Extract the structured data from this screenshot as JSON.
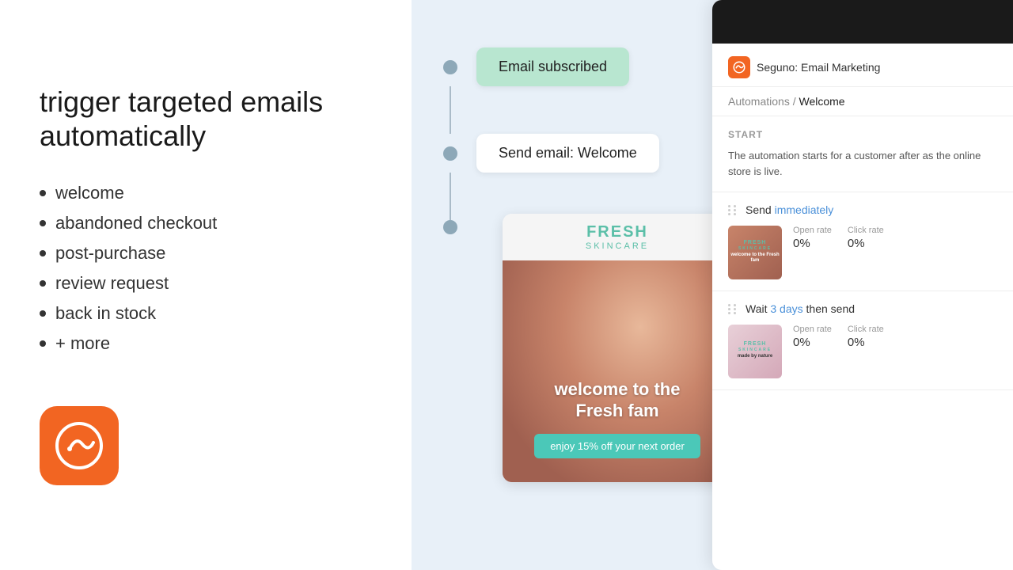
{
  "left": {
    "headline": "trigger targeted emails automatically",
    "bullets": [
      "welcome",
      "abandoned checkout",
      "post-purchase",
      "review request",
      "back in stock",
      "+ more"
    ]
  },
  "workflow": {
    "trigger_label": "Email subscribed",
    "action_label": "Send email: Welcome"
  },
  "email_preview": {
    "brand": "FRESH",
    "brand_sub": "SKINCARE",
    "welcome_line1": "welcome to the",
    "welcome_line2": "Fresh fam",
    "cta": "enjoy 15% off your next order"
  },
  "app": {
    "logo_alt": "Seguno logo",
    "app_name": "Seguno: Email Marketing",
    "breadcrumb_parent": "Automations",
    "breadcrumb_separator": "/",
    "breadcrumb_current": "Welcome",
    "start_label": "START",
    "start_desc": "The automation starts for a customer after as the online store is live.",
    "send_row": {
      "prefix": "Send ",
      "link": "immediately",
      "open_rate_label": "Open rate",
      "open_rate_value": "0%",
      "click_rate_label": "Click rate",
      "click_rate_value": "0%"
    },
    "wait_row": {
      "prefix": "Wait ",
      "link": "3 days",
      "suffix": " then send",
      "open_rate_label": "Open rate",
      "open_rate_value": "0%",
      "click_rate_label": "Click rate",
      "click_rate_value": "0%"
    }
  }
}
